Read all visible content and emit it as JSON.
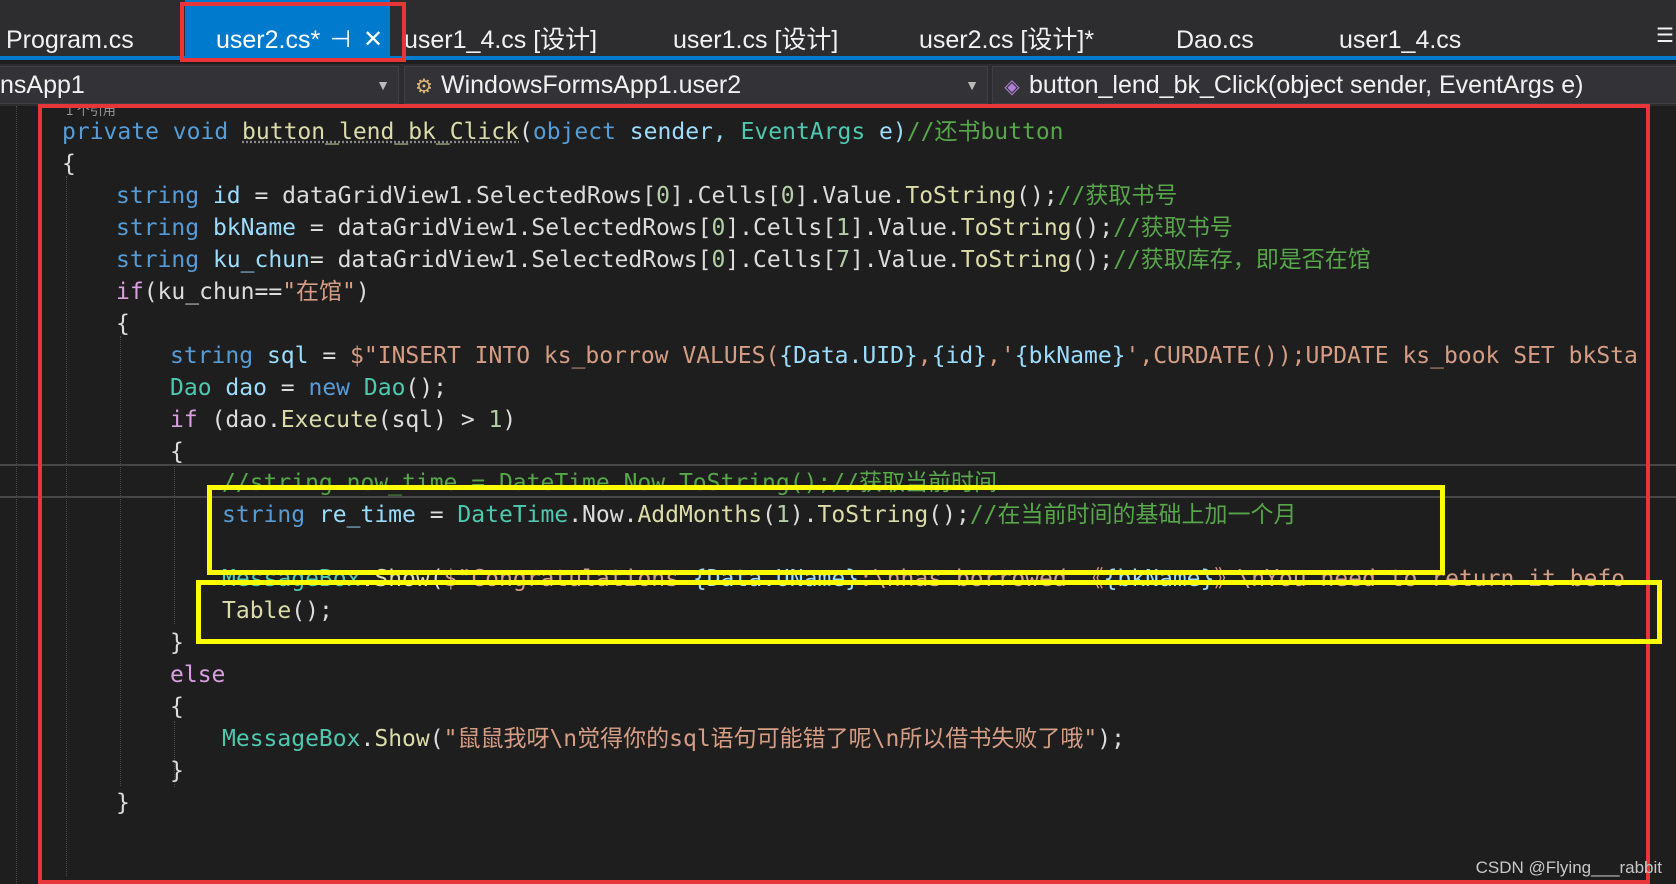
{
  "tabs": [
    {
      "label": "Program.cs",
      "active": false
    },
    {
      "label": "user2.cs*",
      "active": true
    },
    {
      "label": "user1_4.cs [设计]",
      "active": false
    },
    {
      "label": "user1.cs [设计]",
      "active": false
    },
    {
      "label": "user2.cs [设计]*",
      "active": false
    },
    {
      "label": "Dao.cs",
      "active": false
    },
    {
      "label": "user1_4.cs",
      "active": false
    }
  ],
  "tab_icons": {
    "pin": "pin-icon",
    "close": "close-icon",
    "overflow": "tab-overflow-icon"
  },
  "nav": {
    "project": "nsApp1",
    "class": "WindowsFormsApp1.user2",
    "member": "button_lend_bk_Click(object sender, EventArgs e)"
  },
  "codelens": "1 个引用",
  "code": {
    "l1": {
      "kw1": "private",
      "kw2": "void",
      "method": "button_lend_bk_Click",
      "p1": "(",
      "t1": "object",
      "a1": " sender, ",
      "t2": "EventArgs",
      "a2": " e)",
      "comment": "//还书button"
    },
    "l2": {
      "text": "{"
    },
    "l3": {
      "kw": "string",
      "var": " id",
      "rest": " = dataGridView1.SelectedRows[",
      "n1": "0",
      "r2": "].Cells[",
      "n2": "0",
      "r3": "].Value.",
      "fn": "ToString",
      "r4": "();",
      "comment": "//获取书号"
    },
    "l4": {
      "kw": "string",
      "var": " bkName",
      "rest": " = dataGridView1.SelectedRows[",
      "n1": "0",
      "r2": "].Cells[",
      "n2": "1",
      "r3": "].Value.",
      "fn": "ToString",
      "r4": "();",
      "comment": "//获取书号"
    },
    "l5": {
      "kw": "string",
      "var": " ku_chun",
      "rest": "= dataGridView1.SelectedRows[",
      "n1": "0",
      "r2": "].Cells[",
      "n2": "7",
      "r3": "].Value.",
      "fn": "ToString",
      "r4": "();",
      "comment": "//获取库存，即是否在馆"
    },
    "l6": {
      "kw": "if",
      "rest": "(ku_chun==",
      "str": "\"在馆\"",
      "end": ")"
    },
    "l7": {
      "text": "{"
    },
    "l8": {
      "kw": "string",
      "var": " sql",
      "eq": " = ",
      "s1": "$\"INSERT INTO ks_borrow VALUES(",
      "i1": "{Data.UID}",
      "s2": ",",
      "i2": "{id}",
      "s3": ",'",
      "i3": "{bkName}",
      "s4": "',CURDATE());UPDATE ks_book SET bkSta"
    },
    "l9": {
      "ty": "Dao",
      "var": " dao",
      "eq": " = ",
      "kw": "new",
      "ty2": " Dao",
      "end": "();"
    },
    "l10": {
      "kw": "if",
      "rest": " (dao.",
      "fn": "Execute",
      "rest2": "(sql) > ",
      "num": "1",
      "end": ")"
    },
    "l11": {
      "text": "{"
    },
    "l12": {
      "comment": "//string now_time = DateTime.Now.ToString();//获取当前时间"
    },
    "l13": {
      "kw": "string",
      "var": " re_time",
      "eq": " = ",
      "ty": "DateTime",
      "r1": ".Now.",
      "fn": "AddMonths",
      "r2": "(",
      "num": "1",
      "r3": ").",
      "fn2": "ToString",
      "r4": "();",
      "comment": "//在当前时间的基础上加一个月"
    },
    "l14": {
      "ty": "MessageBox",
      "dot": ".",
      "fn": "Show",
      "p": "(",
      "s1": "$\"Congratulations ",
      "i1": "{Data.UName}",
      "s2": ":\\nhas borrowed 《",
      "i2": "{bkName}",
      "s3": "》\\nYou need to return it befo"
    },
    "l15": {
      "fn": "Table",
      "end": "();"
    },
    "l16": {
      "text": "}"
    },
    "l17": {
      "kw": "else"
    },
    "l18": {
      "text": "{"
    },
    "l19": {
      "ty": "MessageBox",
      "dot": ".",
      "fn": "Show",
      "p": "(",
      "str": "\"鼠鼠我呀\\n觉得你的sql语句可能错了呢\\n所以借书失败了哦\"",
      "end": ");"
    },
    "l20": {
      "text": "}"
    },
    "l21": {
      "text": "}"
    }
  },
  "watermark": "CSDN @Flying___rabbit",
  "colors": {
    "editor_bg": "#1e1e1e",
    "tab_active": "#007acc",
    "annotation_red": "#e8353a",
    "annotation_yellow": "#ffff00"
  }
}
